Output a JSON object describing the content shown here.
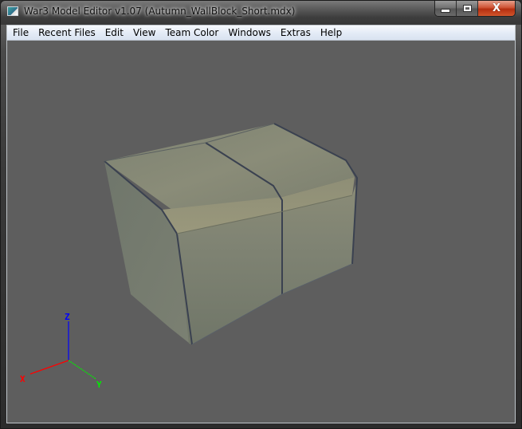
{
  "window": {
    "title": "War3 Model Editor v1.07 (Autumn_WallBlock_Short.mdx)",
    "app_icon": "war3-model-editor-icon",
    "caption_buttons": {
      "minimize_icon": "minimize-icon",
      "maximize_icon": "maximize-icon",
      "close_icon": "close-icon",
      "close_glyph": "X"
    }
  },
  "menu": {
    "items": [
      {
        "label": "File"
      },
      {
        "label": "Recent Files"
      },
      {
        "label": "Edit"
      },
      {
        "label": "View"
      },
      {
        "label": "Team Color"
      },
      {
        "label": "Windows"
      },
      {
        "label": "Extras"
      },
      {
        "label": "Help"
      }
    ]
  },
  "viewport": {
    "background_color": "#5e5e5e",
    "model": "Autumn_WallBlock_Short.mdx",
    "axis_gizmo": {
      "x_label": "X",
      "y_label": "Y",
      "z_label": "Z",
      "x_color": "#ff0000",
      "y_color": "#00ff00",
      "z_color": "#0000ff"
    }
  }
}
